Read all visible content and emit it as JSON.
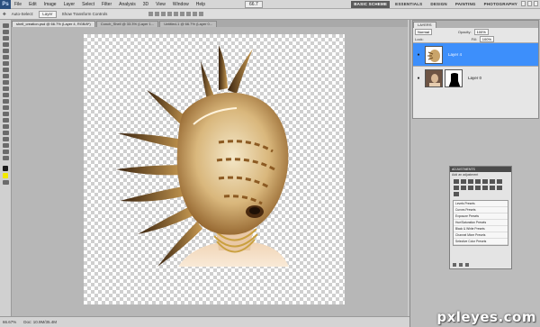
{
  "menubar": {
    "logo": "Ps",
    "items": [
      "File",
      "Edit",
      "Image",
      "Layer",
      "Select",
      "Filter",
      "Analysis",
      "3D",
      "View",
      "Window",
      "Help"
    ],
    "zoom": "66.7",
    "workspaces": [
      "ESSENTIALS",
      "DESIGN",
      "PAINTING",
      "PHOTOGRAPHY"
    ],
    "active_workspace": "BASIC SCHEME"
  },
  "options": {
    "auto_select_label": "Auto-Select:",
    "auto_select_value": "Layer",
    "transform_label": "Show Transform Controls"
  },
  "tabs": [
    {
      "label": "shell_creation.psd @ 66.7% (Layer 4, RGB/8*)",
      "active": true
    },
    {
      "label": "Conch_Shell @ 33.3% (Layer 1...",
      "active": false
    },
    {
      "label": "Untitled-1 @ 66.7% (Layer 0...",
      "active": false
    }
  ],
  "status": {
    "zoom": "66.67%",
    "doc": "Doc: 10.9M/35.4M"
  },
  "layers_panel": {
    "tab": "LAYERS",
    "blend_mode": "Normal",
    "opacity_label": "Opacity:",
    "opacity": "100%",
    "lock_label": "Lock:",
    "fill_label": "Fill:",
    "fill": "100%",
    "layers": [
      {
        "name": "Layer 4",
        "visible_icon": "eye-icon",
        "selected": true
      },
      {
        "name": "Layer 0",
        "visible_icon": "eye-icon",
        "selected": false
      }
    ]
  },
  "adjustments": {
    "title": "ADJUSTMENTS",
    "subtitle": "Add an adjustment",
    "presets": [
      "Levels Presets",
      "Curves Presets",
      "Exposure Presets",
      "Hue/Saturation Presets",
      "Black & White Presets",
      "Channel Mixer Presets",
      "Selective Color Presets"
    ]
  },
  "watermark": "pxleyes.com",
  "colors": {
    "selected_layer": "#3d8ffb",
    "shell_light": "#f1e3c2",
    "shell_dark": "#7a4a1a",
    "skin": "#f3ddc4",
    "necklace": "#d8b24a"
  }
}
